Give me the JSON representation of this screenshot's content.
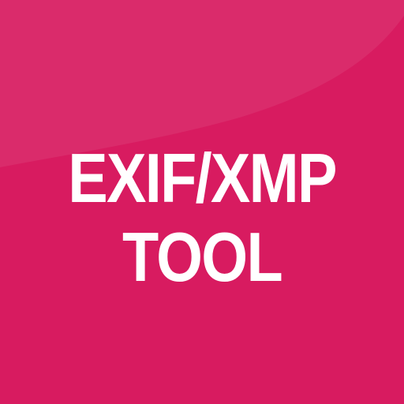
{
  "icon": {
    "background_color": "#d81b60",
    "text_color": "#ffffff",
    "lines": [
      "EXIF/XMP",
      "TOOL"
    ]
  }
}
